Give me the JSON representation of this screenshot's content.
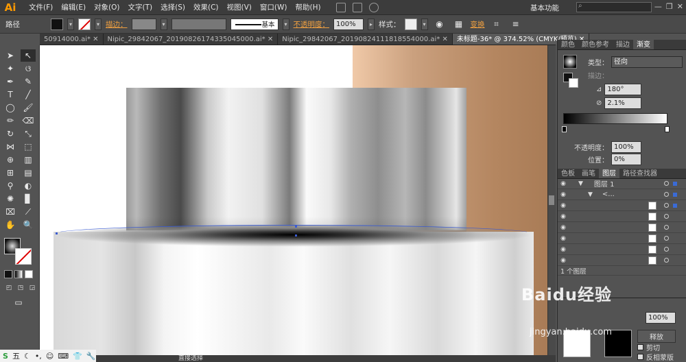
{
  "app": {
    "logo": "Ai"
  },
  "menu": [
    "文件(F)",
    "编辑(E)",
    "对象(O)",
    "文字(T)",
    "选择(S)",
    "效果(C)",
    "视图(V)",
    "窗口(W)",
    "帮助(H)"
  ],
  "menubar": {
    "workspace": "基本功能",
    "minimize": "—",
    "maximize": "❐",
    "close": "✕"
  },
  "control_bar": {
    "path_label": "路径",
    "stroke_label": "描边：",
    "stroke_profile": "基本",
    "opacity_label": "不透明度：",
    "opacity_value": "100%",
    "style_label": "样式：",
    "transform_label": "变换"
  },
  "tabs": [
    {
      "label": "50914000.ai* ✕",
      "active": false
    },
    {
      "label": "Nipic_29842067_20190826174335045000.ai* ✕",
      "active": false
    },
    {
      "label": "Nipic_29842067_20190824111818554000.ai* ✕",
      "active": false
    },
    {
      "label": "未标题-36* @ 374.52% (CMYK/预览) ✕",
      "active": true
    }
  ],
  "gradient_panel": {
    "tabs": [
      "颜色",
      "颜色参考",
      "描边",
      "渐变"
    ],
    "type_label": "类型：",
    "type_value": "径向",
    "stroke_label": "描边：",
    "angle": "180°",
    "aspect": "2.1%",
    "opacity_label": "不透明度：",
    "opacity_value": "100%",
    "position_label": "位置：",
    "position_value": "0%"
  },
  "layers_panel": {
    "tabs": [
      "色板",
      "画笔",
      "图层",
      "路径查找器"
    ],
    "layer_name": "图层 1",
    "sublayer": "<...",
    "footer": "1 个图层",
    "release_button": "释放",
    "clip_label": "剪切",
    "invert_label": "反相蒙版",
    "opacity_value": "100%"
  },
  "status": {
    "tool": "直接选择"
  },
  "watermark": {
    "main": "Baidu经验",
    "sub": "jingyan.baidu.com"
  },
  "tray": {
    "ime": "五"
  },
  "colors": {
    "accent": "#3a5bd0",
    "brand": "#ff9a00"
  }
}
